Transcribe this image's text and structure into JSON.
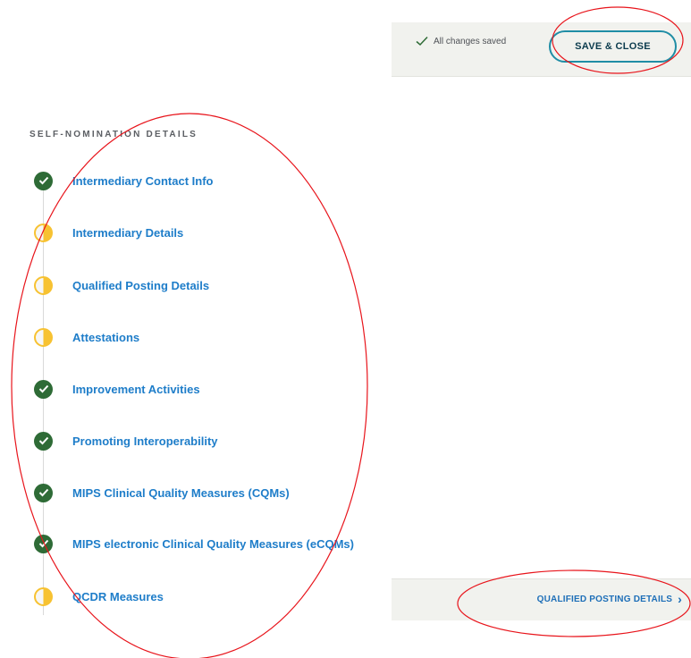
{
  "header": {
    "saved_status": "All changes saved",
    "save_button": "SAVE & CLOSE"
  },
  "sidebar": {
    "section_title": "SELF-NOMINATION DETAILS",
    "items": [
      {
        "label": "Intermediary Contact Info",
        "status": "complete"
      },
      {
        "label": "Intermediary Details",
        "status": "partial"
      },
      {
        "label": "Qualified Posting Details",
        "status": "partial"
      },
      {
        "label": "Attestations",
        "status": "partial"
      },
      {
        "label": "Improvement Activities",
        "status": "complete"
      },
      {
        "label": "Promoting Interoperability",
        "status": "complete"
      },
      {
        "label": "MIPS Clinical Quality Measures (CQMs)",
        "status": "complete"
      },
      {
        "label": "MIPS electronic Clinical Quality Measures (eCQMs)",
        "status": "complete"
      },
      {
        "label": "QCDR Measures",
        "status": "partial"
      }
    ]
  },
  "footer": {
    "next_link": "QUALIFIED POSTING DETAILS",
    "next_arrow": "›"
  },
  "colors": {
    "link": "#1e7dc9",
    "complete": "#2e6b36",
    "partial": "#f7c232",
    "button_border": "#1f8da5",
    "annotation": "#e8141b"
  }
}
